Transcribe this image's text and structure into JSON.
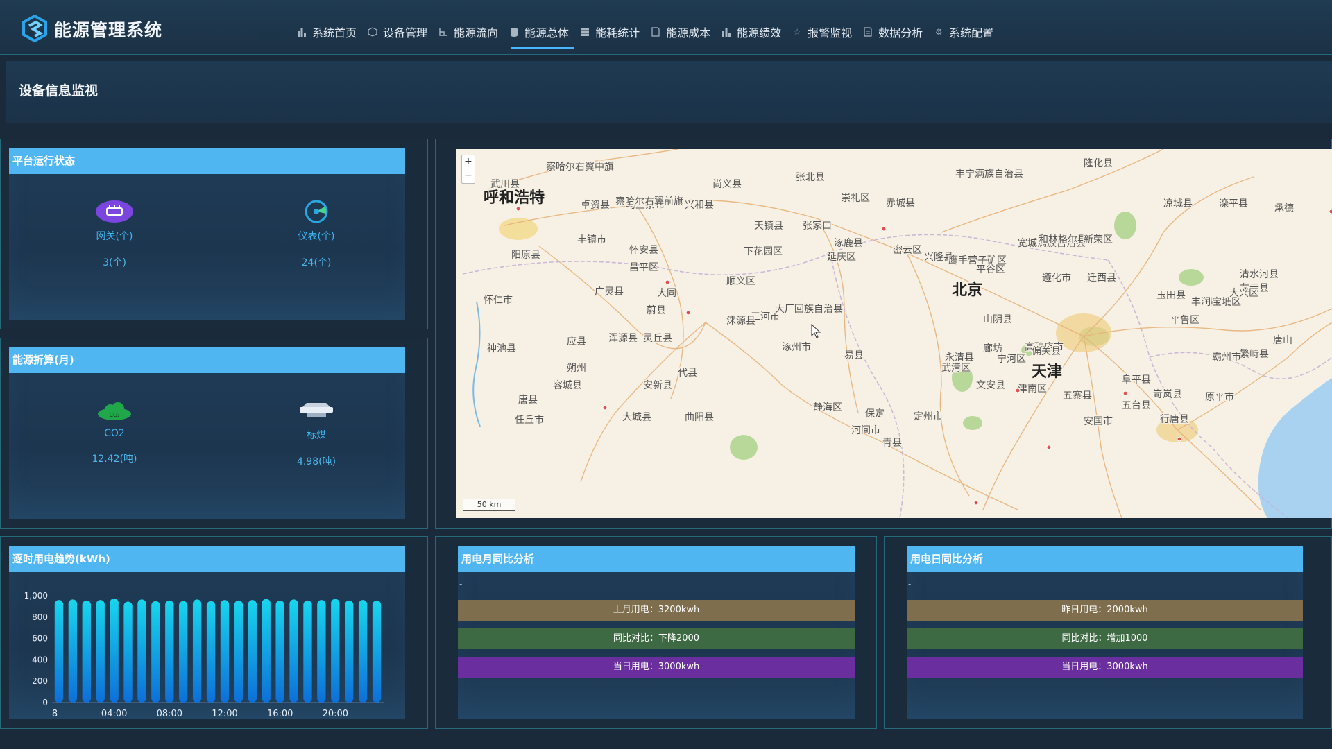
{
  "app": {
    "title": "能源管理系统"
  },
  "nav": [
    {
      "label": "系统首页",
      "icon": "bar-chart-icon"
    },
    {
      "label": "设备管理",
      "icon": "cube-icon"
    },
    {
      "label": "能源流向",
      "icon": "flow-icon"
    },
    {
      "label": "能源总体",
      "icon": "database-icon",
      "active": true
    },
    {
      "label": "能耗统计",
      "icon": "grid-icon"
    },
    {
      "label": "能源成本",
      "icon": "document-icon"
    },
    {
      "label": "能源绩效",
      "icon": "bar-chart-icon"
    },
    {
      "label": "报警监视",
      "icon": "star-icon"
    },
    {
      "label": "数据分析",
      "icon": "document-icon"
    },
    {
      "label": "系统配置",
      "icon": "gear-icon"
    }
  ],
  "page": {
    "section_title": "设备信息监视"
  },
  "platform": {
    "title": "平台运行状态",
    "gateway": {
      "label": "网关(个)",
      "value": "3(个)"
    },
    "meter": {
      "label": "仪表(个)",
      "value": "24(个)"
    }
  },
  "energy": {
    "title": "能源折算(月)",
    "co2": {
      "label": "CO2",
      "value": "12.42(吨)",
      "icon_text": "CO₂"
    },
    "coal": {
      "label": "标煤",
      "value": "4.98(吨)"
    }
  },
  "map": {
    "zoom_in": "+",
    "zoom_out": "−",
    "scale": "50 km",
    "places": [
      {
        "name": "呼和浩特",
        "big": true
      },
      {
        "name": "乌兰察布",
        "big": false
      },
      {
        "name": "张家口",
        "big": false
      },
      {
        "name": "大同",
        "big": false
      },
      {
        "name": "北京",
        "big": true
      },
      {
        "name": "天津",
        "big": true
      },
      {
        "name": "廊坊",
        "big": false
      },
      {
        "name": "保定",
        "big": false
      },
      {
        "name": "朔州",
        "big": false
      },
      {
        "name": "承德",
        "big": false
      },
      {
        "name": "唐山",
        "big": false
      },
      {
        "name": "察哈尔右翼中旗",
        "big": false
      },
      {
        "name": "察哈尔右翼前旗",
        "big": false
      },
      {
        "name": "武川县",
        "big": false
      },
      {
        "name": "卓资县",
        "big": false
      },
      {
        "name": "兴和县",
        "big": false
      },
      {
        "name": "尚义县",
        "big": false
      },
      {
        "name": "张北县",
        "big": false
      },
      {
        "name": "崇礼区",
        "big": false
      },
      {
        "name": "赤城县",
        "big": false
      },
      {
        "name": "丰宁满族自治县",
        "big": false
      },
      {
        "name": "隆化县",
        "big": false
      },
      {
        "name": "滦平县",
        "big": false
      },
      {
        "name": "凉城县",
        "big": false
      },
      {
        "name": "丰镇市",
        "big": false
      },
      {
        "name": "怀安县",
        "big": false
      },
      {
        "name": "天镇县",
        "big": false
      },
      {
        "name": "下花园区",
        "big": false
      },
      {
        "name": "涿鹿县",
        "big": false
      },
      {
        "name": "延庆区",
        "big": false
      },
      {
        "name": "密云区",
        "big": false
      },
      {
        "name": "兴隆县",
        "big": false
      },
      {
        "name": "鹰手营子矿区",
        "big": false
      },
      {
        "name": "宽城满族自治县",
        "big": false
      },
      {
        "name": "和林格尔县",
        "big": false
      },
      {
        "name": "新荣区",
        "big": false
      },
      {
        "name": "阳原县",
        "big": false
      },
      {
        "name": "昌平区",
        "big": false
      },
      {
        "name": "顺义区",
        "big": false
      },
      {
        "name": "平谷区",
        "big": false
      },
      {
        "name": "遵化市",
        "big": false
      },
      {
        "name": "迁西县",
        "big": false
      },
      {
        "name": "清水河县",
        "big": false
      },
      {
        "name": "左云县",
        "big": false
      },
      {
        "name": "怀仁市",
        "big": false
      },
      {
        "name": "广灵县",
        "big": false
      },
      {
        "name": "蔚县",
        "big": false
      },
      {
        "name": "三河市",
        "big": false
      },
      {
        "name": "大厂回族自治县",
        "big": false
      },
      {
        "name": "玉田县",
        "big": false
      },
      {
        "name": "丰润区",
        "big": false
      },
      {
        "name": "宝坻区",
        "big": false
      },
      {
        "name": "大兴区",
        "big": false
      },
      {
        "name": "平鲁区",
        "big": false
      },
      {
        "name": "山阴县",
        "big": false
      },
      {
        "name": "应县",
        "big": false
      },
      {
        "name": "浑源县",
        "big": false
      },
      {
        "name": "灵丘县",
        "big": false
      },
      {
        "name": "涞源县",
        "big": false
      },
      {
        "name": "涿州市",
        "big": false
      },
      {
        "name": "易县",
        "big": false
      },
      {
        "name": "高碑店市",
        "big": false
      },
      {
        "name": "永清县",
        "big": false
      },
      {
        "name": "武清区",
        "big": false
      },
      {
        "name": "宁河区",
        "big": false
      },
      {
        "name": "偏关县",
        "big": false
      },
      {
        "name": "繁峙县",
        "big": false
      },
      {
        "name": "霸州市",
        "big": false
      },
      {
        "name": "神池县",
        "big": false
      },
      {
        "name": "代县",
        "big": false
      },
      {
        "name": "阜平县",
        "big": false
      },
      {
        "name": "容城县",
        "big": false
      },
      {
        "name": "安新县",
        "big": false
      },
      {
        "name": "静海区",
        "big": false
      },
      {
        "name": "津南区",
        "big": false
      },
      {
        "name": "文安县",
        "big": false
      },
      {
        "name": "五寨县",
        "big": false
      },
      {
        "name": "岢岚县",
        "big": false
      },
      {
        "name": "原平市",
        "big": false
      },
      {
        "name": "五台县",
        "big": false
      },
      {
        "name": "唐县",
        "big": false
      },
      {
        "name": "任丘市",
        "big": false
      },
      {
        "name": "大城县",
        "big": false
      },
      {
        "name": "曲阳县",
        "big": false
      },
      {
        "name": "定州市",
        "big": false
      },
      {
        "name": "安国市",
        "big": false
      },
      {
        "name": "行唐县",
        "big": false
      },
      {
        "name": "河间市",
        "big": false
      },
      {
        "name": "青县",
        "big": false
      }
    ]
  },
  "trend": {
    "title": "逐时用电趋势(kWh)"
  },
  "month_compare": {
    "title": "用电月同比分析",
    "dash": "-",
    "rows": [
      "上月用电：3200kwh",
      "同比对比：下降2000",
      "当日用电：3000kwh"
    ]
  },
  "day_compare": {
    "title": "用电日同比分析",
    "dash": "-",
    "rows": [
      "昨日用电：2000kwh",
      "同比对比：增加1000",
      "当日用电：3000kwh"
    ]
  },
  "chart_data": {
    "type": "bar",
    "title": "逐时用电趋势(kWh)",
    "x": [
      "0",
      "1",
      "2",
      "3",
      "4",
      "5",
      "6",
      "7",
      "8",
      "9",
      "10",
      "11",
      "12",
      "13",
      "14",
      "15",
      "16",
      "17",
      "18",
      "19",
      "20",
      "21",
      "22",
      "23"
    ],
    "xtick_labels": [
      "8",
      "04:00",
      "08:00",
      "12:00",
      "16:00",
      "20:00"
    ],
    "values": [
      960,
      965,
      955,
      960,
      975,
      945,
      965,
      950,
      955,
      950,
      965,
      950,
      960,
      955,
      960,
      970,
      955,
      965,
      955,
      960,
      970,
      955,
      960,
      955
    ],
    "ylim": [
      0,
      1000
    ],
    "yticks": [
      "0",
      "200",
      "400",
      "600",
      "800",
      "1,000"
    ],
    "grid": false,
    "color": "#16c7e6"
  }
}
